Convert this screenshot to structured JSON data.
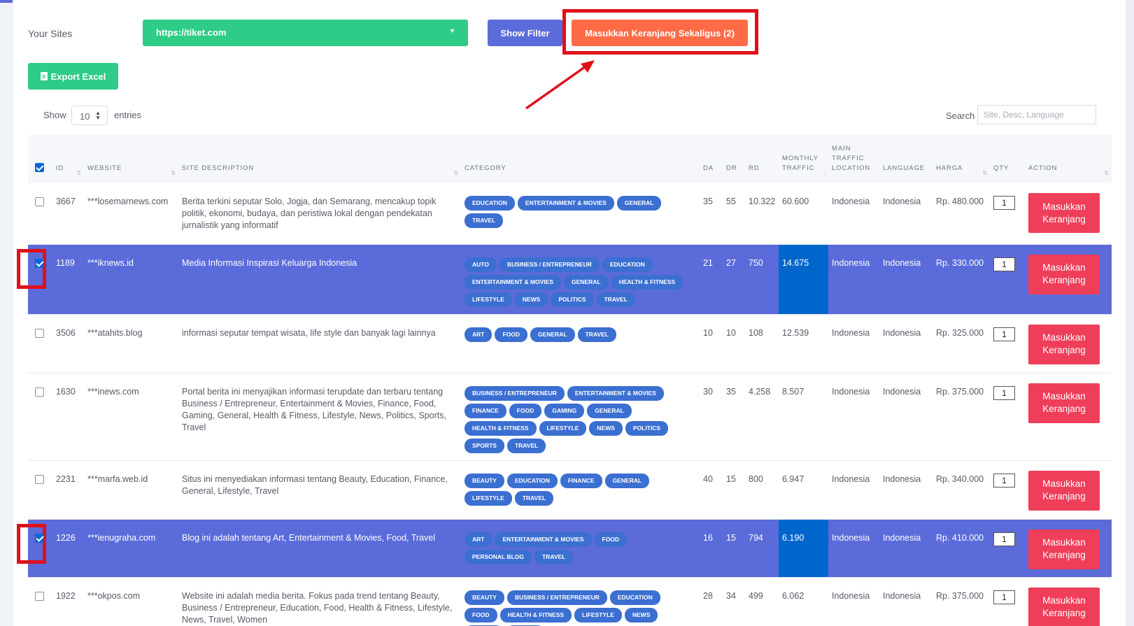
{
  "top": {
    "your_sites_label": "Your Sites",
    "site_value": "https://tiket.com",
    "show_filter_label": "Show Filter",
    "bulk_cart_label": "Masukkan Keranjang Sekaligus (2)",
    "export_label": "Export Excel"
  },
  "length": {
    "show_label": "Show",
    "value": "10",
    "entries_label": "entries"
  },
  "search": {
    "label": "Search",
    "placeholder": "Site, Desc, Language"
  },
  "columns": {
    "id": "ID",
    "website": "WEBSITE",
    "desc": "SITE DESCRIPTION",
    "category": "CATEGORY",
    "da": "DA",
    "dr": "DR",
    "rd": "RD",
    "traffic_1": "MONTHLY",
    "traffic_2": "TRAFFIC",
    "loc_1": "MAIN",
    "loc_2": "TRAFFIC",
    "loc_3": "LOCATION",
    "language": "LANGUAGE",
    "harga": "HARGA",
    "qty": "QTY",
    "action": "ACTION"
  },
  "action_label": "Masukkan Keranjang",
  "rows": [
    {
      "id": "3667",
      "website": "***losemarnews.com",
      "desc": "Berita terkini seputar Solo, Jogja, dan Semarang, mencakup topik politik, ekonomi, budaya, dan peristiwa lokal dengan pendekatan jurnalistik yang informatif",
      "categories": [
        "EDUCATION",
        "ENTERTAINMENT & MOVIES",
        "GENERAL",
        "TRAVEL"
      ],
      "da": "35",
      "dr": "55",
      "rd": "10.322",
      "traffic": "60.600",
      "location": "Indonesia",
      "language": "Indonesia",
      "harga": "Rp. 480.000",
      "qty": "1",
      "selected": false
    },
    {
      "id": "1189",
      "website": "***iknews.id",
      "desc": "Media Informasi Inspirasi Keluarga Indonesia",
      "categories": [
        "AUTO",
        "BUSINESS / ENTREPRENEUR",
        "EDUCATION",
        "ENTERTAINMENT & MOVIES",
        "GENERAL",
        "HEALTH & FITNESS",
        "LIFESTYLE",
        "NEWS",
        "POLITICS",
        "TRAVEL"
      ],
      "da": "21",
      "dr": "27",
      "rd": "750",
      "traffic": "14.675",
      "location": "Indonesia",
      "language": "Indonesia",
      "harga": "Rp. 330.000",
      "qty": "1",
      "selected": true
    },
    {
      "id": "3506",
      "website": "***atahits.blog",
      "desc": "informasi seputar tempat wisata, life style dan banyak lagi lainnya",
      "categories": [
        "ART",
        "FOOD",
        "GENERAL",
        "TRAVEL"
      ],
      "da": "10",
      "dr": "10",
      "rd": "108",
      "traffic": "12.539",
      "location": "Indonesia",
      "language": "Indonesia",
      "harga": "Rp. 325.000",
      "qty": "1",
      "selected": false
    },
    {
      "id": "1630",
      "website": "***inews.com",
      "desc": "Portal berita ini menyajikan informasi terupdate dan terbaru tentang Business / Entrepreneur, Entertainment & Movies, Finance, Food, Gaming, General, Health & Fitness, Lifestyle, News, Politics, Sports, Travel",
      "categories": [
        "BUSINESS / ENTREPRENEUR",
        "ENTERTAINMENT & MOVIES",
        "FINANCE",
        "FOOD",
        "GAMING",
        "GENERAL",
        "HEALTH & FITNESS",
        "LIFESTYLE",
        "NEWS",
        "POLITICS",
        "SPORTS",
        "TRAVEL"
      ],
      "da": "30",
      "dr": "35",
      "rd": "4.258",
      "traffic": "8.507",
      "location": "Indonesia",
      "language": "Indonesia",
      "harga": "Rp. 375.000",
      "qty": "1",
      "selected": false
    },
    {
      "id": "2231",
      "website": "***marfa.web.id",
      "desc": "Situs ini menyediakan informasi tentang Beauty, Education, Finance, General, Lifestyle, Travel",
      "categories": [
        "BEAUTY",
        "EDUCATION",
        "FINANCE",
        "GENERAL",
        "LIFESTYLE",
        "TRAVEL"
      ],
      "da": "40",
      "dr": "15",
      "rd": "800",
      "traffic": "6.947",
      "location": "Indonesia",
      "language": "Indonesia",
      "harga": "Rp. 340.000",
      "qty": "1",
      "selected": false
    },
    {
      "id": "1226",
      "website": "***ienugraha.com",
      "desc": "Blog ini adalah tentang Art, Entertainment & Movies, Food, Travel",
      "categories": [
        "ART",
        "ENTERTAINMENT & MOVIES",
        "FOOD",
        "PERSONAL BLOG",
        "TRAVEL"
      ],
      "da": "16",
      "dr": "15",
      "rd": "794",
      "traffic": "6.190",
      "location": "Indonesia",
      "language": "Indonesia",
      "harga": "Rp. 410.000",
      "qty": "1",
      "selected": true
    },
    {
      "id": "1922",
      "website": "***okpos.com",
      "desc": "Website ini adalah media berita. Fokus pada trend tentang Beauty, Business / Entrepreneur, Education, Food, Health & Fitness, Lifestyle, News, Travel, Women",
      "categories": [
        "BEAUTY",
        "BUSINESS / ENTREPRENEUR",
        "EDUCATION",
        "FOOD",
        "HEALTH & FITNESS",
        "LIFESTYLE",
        "NEWS",
        "TRAVEL",
        "WOMEN"
      ],
      "da": "28",
      "dr": "34",
      "rd": "499",
      "traffic": "6.062",
      "location": "Indonesia",
      "language": "Indonesia",
      "harga": "Rp. 375.000",
      "qty": "1",
      "selected": false
    }
  ]
}
